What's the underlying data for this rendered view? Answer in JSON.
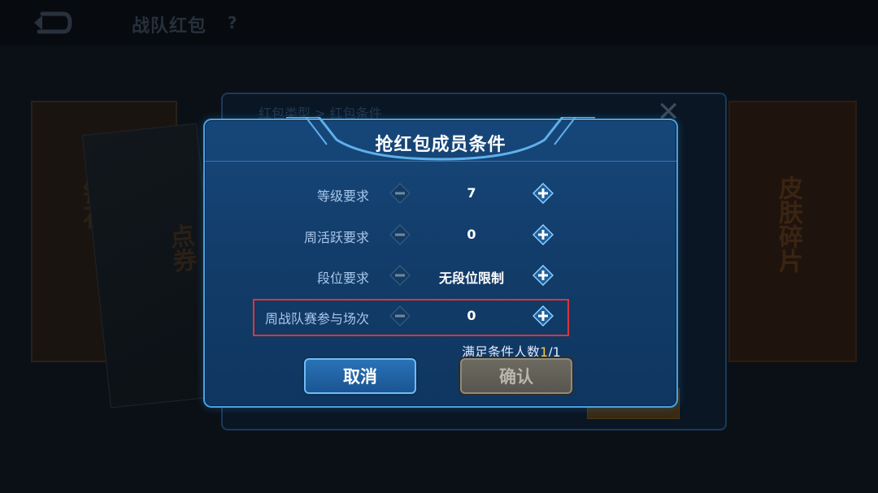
{
  "top_bar": {
    "title": "战队红包",
    "help": "?"
  },
  "background": {
    "breadcrumb": "红包类型 > 红包条件",
    "close": "✕",
    "left_card_text": "钻石",
    "left_art_text": "点券",
    "right_card_text": "皮肤碎片"
  },
  "dialog": {
    "title": "抢红包成员条件",
    "rows": [
      {
        "label": "等级要求",
        "value": "7"
      },
      {
        "label": "周活跃要求",
        "value": "0"
      },
      {
        "label": "段位要求",
        "value": "无段位限制"
      },
      {
        "label": "周战队赛参与场次",
        "value": "0"
      }
    ],
    "qualified_label": "满足条件人数",
    "qualified_count": "1",
    "qualified_total": "/1",
    "cancel_label": "取消",
    "confirm_label": "确认"
  },
  "colors": {
    "accent": "#4aa1e0",
    "highlight": "#e0343a",
    "count": "#ffc93a"
  }
}
